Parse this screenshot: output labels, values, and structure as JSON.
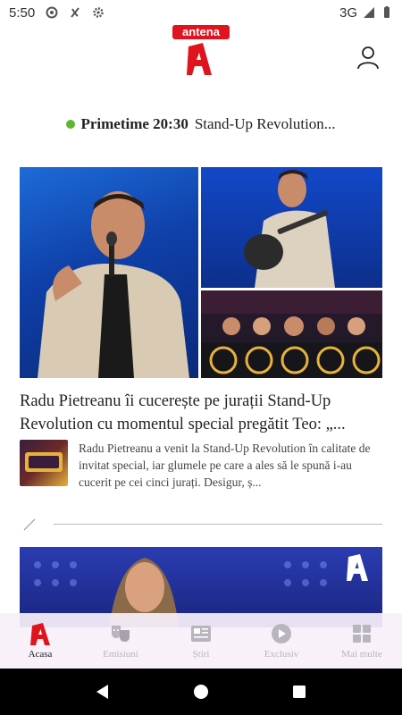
{
  "status_bar": {
    "time": "5:50",
    "network": "3G"
  },
  "header": {
    "logo_text": "antena",
    "brand_color": "#e0141e"
  },
  "live": {
    "time_label": "Primetime 20:30",
    "show": "Stand-Up Revolution...",
    "indicator_color": "#5cb82f"
  },
  "articles": [
    {
      "title": "Radu Pietreanu îi cucerește pe jurații Stand-Up Revolution cu momentul special pregătit Teo: „...",
      "summary": "Radu Pietreanu a venit la Stand-Up Revolution în calitate de invitat special, iar glumele pe care a ales să le spună i-au cucerit pe cei cinci jurați. Desigur, ș..."
    }
  ],
  "bottom_nav": {
    "items": [
      {
        "label": "Acasa",
        "icon": "home-a-icon",
        "active": true
      },
      {
        "label": "Emisiuni",
        "icon": "theater-masks-icon",
        "active": false
      },
      {
        "label": "Știri",
        "icon": "news-icon",
        "active": false
      },
      {
        "label": "Exclusiv",
        "icon": "play-circle-icon",
        "active": false
      },
      {
        "label": "Mai multe",
        "icon": "grid-icon",
        "active": false
      }
    ]
  }
}
